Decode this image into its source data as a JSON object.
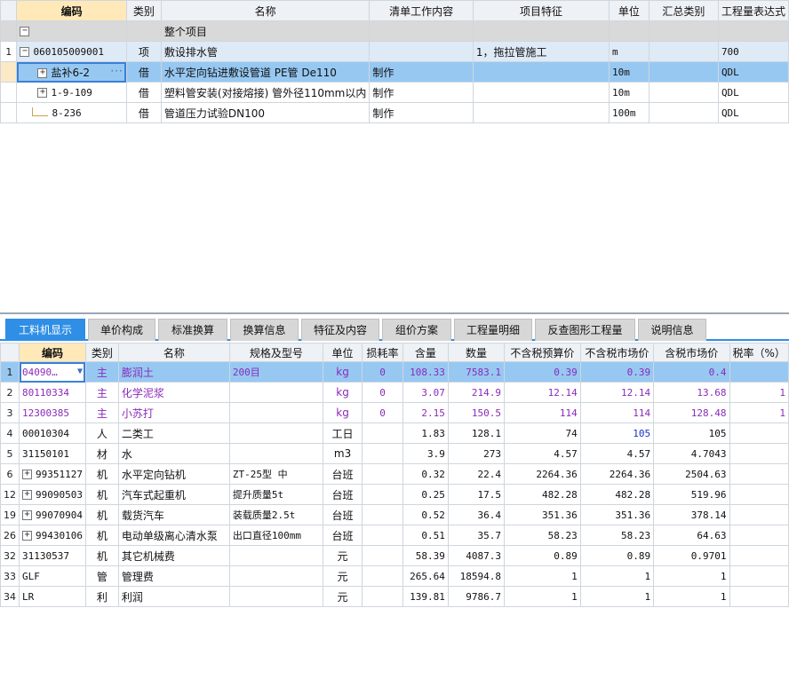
{
  "top_grid": {
    "headers": [
      "编码",
      "类别",
      "名称",
      "清单工作内容",
      "项目特征",
      "单位",
      "汇总类别",
      "工程量表达式"
    ],
    "whole_project": {
      "toggle": "−",
      "label": "整个项目"
    },
    "item_row": {
      "rownum": "1",
      "toggle": "−",
      "code": "060105009001",
      "type": "项",
      "name": "敷设排水管",
      "work": "",
      "feature": "1，拖拉管施工",
      "unit": "m",
      "summary": "",
      "qty_expr": "700"
    },
    "sub_rows": [
      {
        "toggle": "+",
        "code": "盐补6-2",
        "more": "···",
        "type": "借",
        "name": "水平定向钻进敷设管道 PE管 De110",
        "work": "制作",
        "feature": "",
        "unit": "10m",
        "summary": "",
        "qty_expr": "QDL"
      },
      {
        "toggle": "+",
        "code": "1-9-109",
        "more": "",
        "type": "借",
        "name": "塑料管安装(对接熔接) 管外径110mm以内",
        "work": "制作",
        "feature": "",
        "unit": "10m",
        "summary": "",
        "qty_expr": "QDL"
      },
      {
        "toggle": "",
        "code": "8-236",
        "more": "",
        "type": "借",
        "name": "管道压力试验DN100",
        "work": "制作",
        "feature": "",
        "unit": "100m",
        "summary": "",
        "qty_expr": "QDL"
      }
    ]
  },
  "tabs": [
    "工料机显示",
    "单价构成",
    "标准换算",
    "换算信息",
    "特征及内容",
    "组价方案",
    "工程量明细",
    "反查图形工程量",
    "说明信息"
  ],
  "bottom_grid": {
    "headers": [
      "编码",
      "类别",
      "名称",
      "规格及型号",
      "单位",
      "损耗率",
      "含量",
      "数量",
      "不含税预算价",
      "不含税市场价",
      "含税市场价",
      "税率（%）"
    ],
    "rows": [
      {
        "rownum": "1",
        "toggle": "",
        "code": "04090…",
        "dropdown": "▼",
        "type": "主",
        "name": "膨润土",
        "spec": "200目",
        "unit": "kg",
        "loss": "0",
        "content": "108.33",
        "qty": "7583.1",
        "budget": "0.39",
        "market": "0.39",
        "market_tax": "0.4",
        "tax": ""
      },
      {
        "rownum": "2",
        "toggle": "",
        "code": "80110334",
        "dropdown": "",
        "type": "主",
        "name": "化学泥浆",
        "spec": "",
        "unit": "kg",
        "loss": "0",
        "content": "3.07",
        "qty": "214.9",
        "budget": "12.14",
        "market": "12.14",
        "market_tax": "13.68",
        "tax": "1"
      },
      {
        "rownum": "3",
        "toggle": "",
        "code": "12300385",
        "dropdown": "",
        "type": "主",
        "name": "小苏打",
        "spec": "",
        "unit": "kg",
        "loss": "0",
        "content": "2.15",
        "qty": "150.5",
        "budget": "114",
        "market": "114",
        "market_tax": "128.48",
        "tax": "1"
      },
      {
        "rownum": "4",
        "toggle": "",
        "code": "00010304",
        "dropdown": "",
        "type": "人",
        "name": "二类工",
        "spec": "",
        "unit": "工日",
        "loss": "",
        "content": "1.83",
        "qty": "128.1",
        "budget": "74",
        "market": "105",
        "market_tax": "105",
        "tax": ""
      },
      {
        "rownum": "5",
        "toggle": "",
        "code": "31150101",
        "dropdown": "",
        "type": "材",
        "name": "水",
        "spec": "",
        "unit": "m3",
        "loss": "",
        "content": "3.9",
        "qty": "273",
        "budget": "4.57",
        "market": "4.57",
        "market_tax": "4.7043",
        "tax": ""
      },
      {
        "rownum": "6",
        "toggle": "+",
        "code": "99351127",
        "dropdown": "",
        "type": "机",
        "name": "水平定向钻机",
        "spec": "ZT-25型 中",
        "unit": "台班",
        "loss": "",
        "content": "0.32",
        "qty": "22.4",
        "budget": "2264.36",
        "market": "2264.36",
        "market_tax": "2504.63",
        "tax": ""
      },
      {
        "rownum": "12",
        "toggle": "+",
        "code": "99090503",
        "dropdown": "",
        "type": "机",
        "name": "汽车式起重机",
        "spec": "提升质量5t",
        "unit": "台班",
        "loss": "",
        "content": "0.25",
        "qty": "17.5",
        "budget": "482.28",
        "market": "482.28",
        "market_tax": "519.96",
        "tax": ""
      },
      {
        "rownum": "19",
        "toggle": "+",
        "code": "99070904",
        "dropdown": "",
        "type": "机",
        "name": "载货汽车",
        "spec": "装载质量2.5t",
        "unit": "台班",
        "loss": "",
        "content": "0.52",
        "qty": "36.4",
        "budget": "351.36",
        "market": "351.36",
        "market_tax": "378.14",
        "tax": ""
      },
      {
        "rownum": "26",
        "toggle": "+",
        "code": "99430106",
        "dropdown": "",
        "type": "机",
        "name": "电动单级离心清水泵",
        "spec": "出口直径100mm",
        "unit": "台班",
        "loss": "",
        "content": "0.51",
        "qty": "35.7",
        "budget": "58.23",
        "market": "58.23",
        "market_tax": "64.63",
        "tax": ""
      },
      {
        "rownum": "32",
        "toggle": "",
        "code": "31130537",
        "dropdown": "",
        "type": "机",
        "name": "其它机械费",
        "spec": "",
        "unit": "元",
        "loss": "",
        "content": "58.39",
        "qty": "4087.3",
        "budget": "0.89",
        "market": "0.89",
        "market_tax": "0.9701",
        "tax": ""
      },
      {
        "rownum": "33",
        "toggle": "",
        "code": "GLF",
        "dropdown": "",
        "type": "管",
        "name": "管理费",
        "spec": "",
        "unit": "元",
        "loss": "",
        "content": "265.64",
        "qty": "18594.8",
        "budget": "1",
        "market": "1",
        "market_tax": "1",
        "tax": ""
      },
      {
        "rownum": "34",
        "toggle": "",
        "code": "LR",
        "dropdown": "",
        "type": "利",
        "name": "利润",
        "spec": "",
        "unit": "元",
        "loss": "",
        "content": "139.81",
        "qty": "9786.7",
        "budget": "1",
        "market": "1",
        "market_tax": "1",
        "tax": ""
      }
    ]
  },
  "colors": {
    "selected_row": "#97c8f2",
    "accent_tab": "#2f8ee6",
    "main_material_text": "#8a2bb8",
    "changed_price": "#1530c8"
  }
}
